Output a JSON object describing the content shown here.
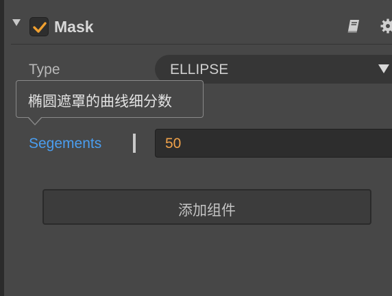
{
  "component": {
    "title": "Mask",
    "enabled": true,
    "icons": [
      "collapse-arrow-icon",
      "checkmark-icon",
      "book-icon",
      "gear-icon"
    ]
  },
  "properties": {
    "type_label": "Type",
    "type_value": "ELLIPSE",
    "segments_label": "Segements",
    "segments_value": "50"
  },
  "tooltip": {
    "text": "椭圆遮罩的曲线细分数"
  },
  "add_component_label": "添加组件",
  "colors": {
    "background": "#474747",
    "accent_checkbox": "#f0a030",
    "label_highlight": "#4a9ef0",
    "number_value": "#f0a24a"
  }
}
